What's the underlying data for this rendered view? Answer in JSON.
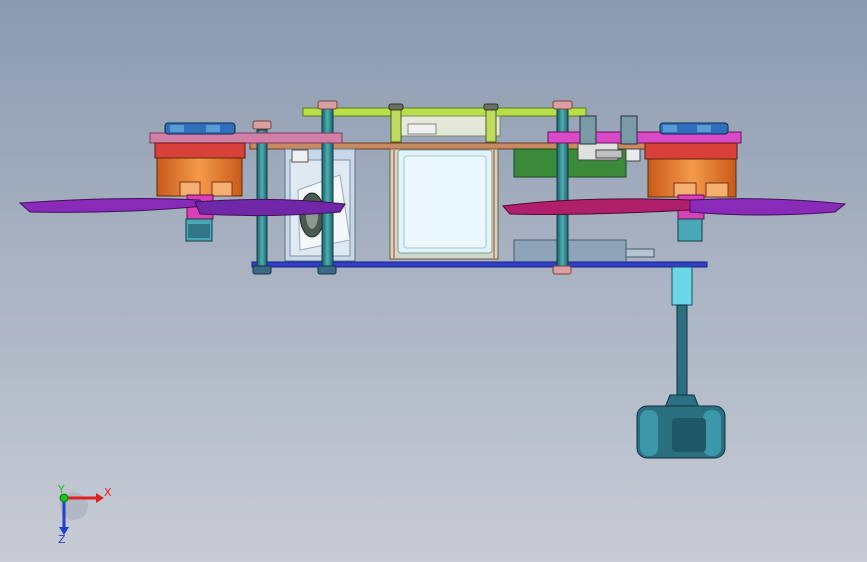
{
  "viewport": {
    "background_top": "#8c9bb0",
    "background_bottom": "#c8ccd6"
  },
  "model": {
    "colors": {
      "motor_orange": "#f07a2a",
      "motor_red": "#d8403a",
      "motor_mount_pink": "#d27fa8",
      "motor_mount_magenta": "#d84ac8",
      "bolt_blue": "#2d6fb8",
      "standoff_teal": "#2c8a8a",
      "top_plate_lime": "#b9e04a",
      "frame_copper": "#c88a60",
      "bottom_plate_blue": "#3040c8",
      "battery_cyan": "#d8f2fb",
      "pcb_green": "#3a8a3a",
      "prop_left_purple": "#8a2ab8",
      "prop_right_crimson": "#b0206a",
      "landing_foot_teal": "#2a7080",
      "camera_gray": "#c8d8e8"
    }
  },
  "triad": {
    "x_label": "X",
    "y_label": "Y",
    "z_label": "Z",
    "x_color": "#e02020",
    "y_color": "#20c020",
    "z_color": "#2040d0"
  }
}
